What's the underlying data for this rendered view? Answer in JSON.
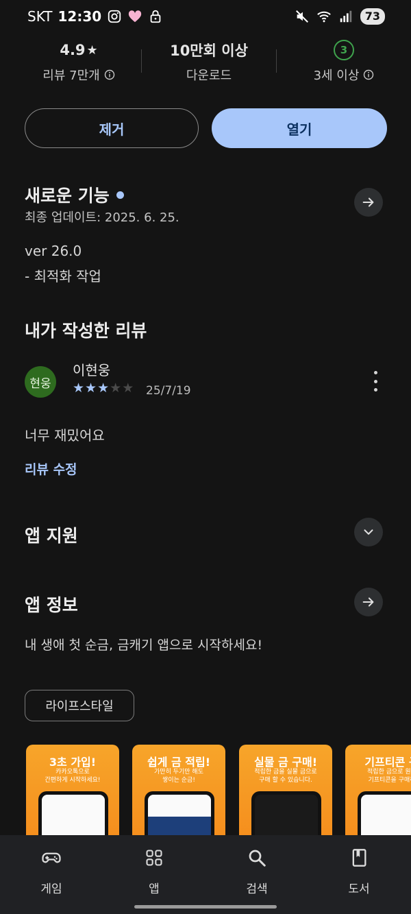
{
  "status_bar": {
    "carrier": "SKT",
    "time": "12:30",
    "battery": "73"
  },
  "stats": {
    "rating": {
      "value": "4.9",
      "label": "리뷰 7만개"
    },
    "downloads": {
      "value": "10만회 이상",
      "label": "다운로드"
    },
    "age": {
      "badge": "3",
      "label": "3세 이상"
    }
  },
  "actions": {
    "remove_label": "제거",
    "open_label": "열기"
  },
  "whats_new": {
    "title": "새로운 기능",
    "updated": "최종 업데이트: 2025. 6. 25.",
    "version": "ver 26.0",
    "notes": "- 최적화 작업"
  },
  "my_review": {
    "title": "내가 작성한 리뷰",
    "avatar_text": "현웅",
    "reviewer": "이현웅",
    "stars": 3,
    "date": "25/7/19",
    "body": "너무 재밌어요",
    "edit_label": "리뷰 수정"
  },
  "app_support": {
    "title": "앱 지원"
  },
  "app_info": {
    "title": "앱 정보",
    "description": "내 생애 첫 순금, 금캐기 앱으로 시작하세요!",
    "category_chip": "라이프스타일"
  },
  "screenshots": [
    {
      "heading": "3초 가입!",
      "sub": "카카오톡으로\n간편하게 시작하세요!"
    },
    {
      "heading": "쉽게 금 적립!",
      "sub": "가만히 두기만 해도\n쌓이는 순금!"
    },
    {
      "heading": "실물 금 구매!",
      "sub": "적립한 금을 실물 금으로\n구매 할 수 있습니다."
    },
    {
      "heading": "기프티콘 구",
      "sub": "적립한 금으로 원하\n기프티콘을 구매하"
    }
  ],
  "bottom_nav": [
    {
      "label": "게임",
      "icon": "gamepad-icon"
    },
    {
      "label": "앱",
      "icon": "apps-grid-icon"
    },
    {
      "label": "검색",
      "icon": "search-icon"
    },
    {
      "label": "도서",
      "icon": "book-icon"
    }
  ],
  "colors": {
    "accent": "#a8c7fa",
    "background": "#141414",
    "avatar": "#2e6b1f",
    "age_badge": "#3fa34d",
    "promo": "#f7a52a"
  }
}
